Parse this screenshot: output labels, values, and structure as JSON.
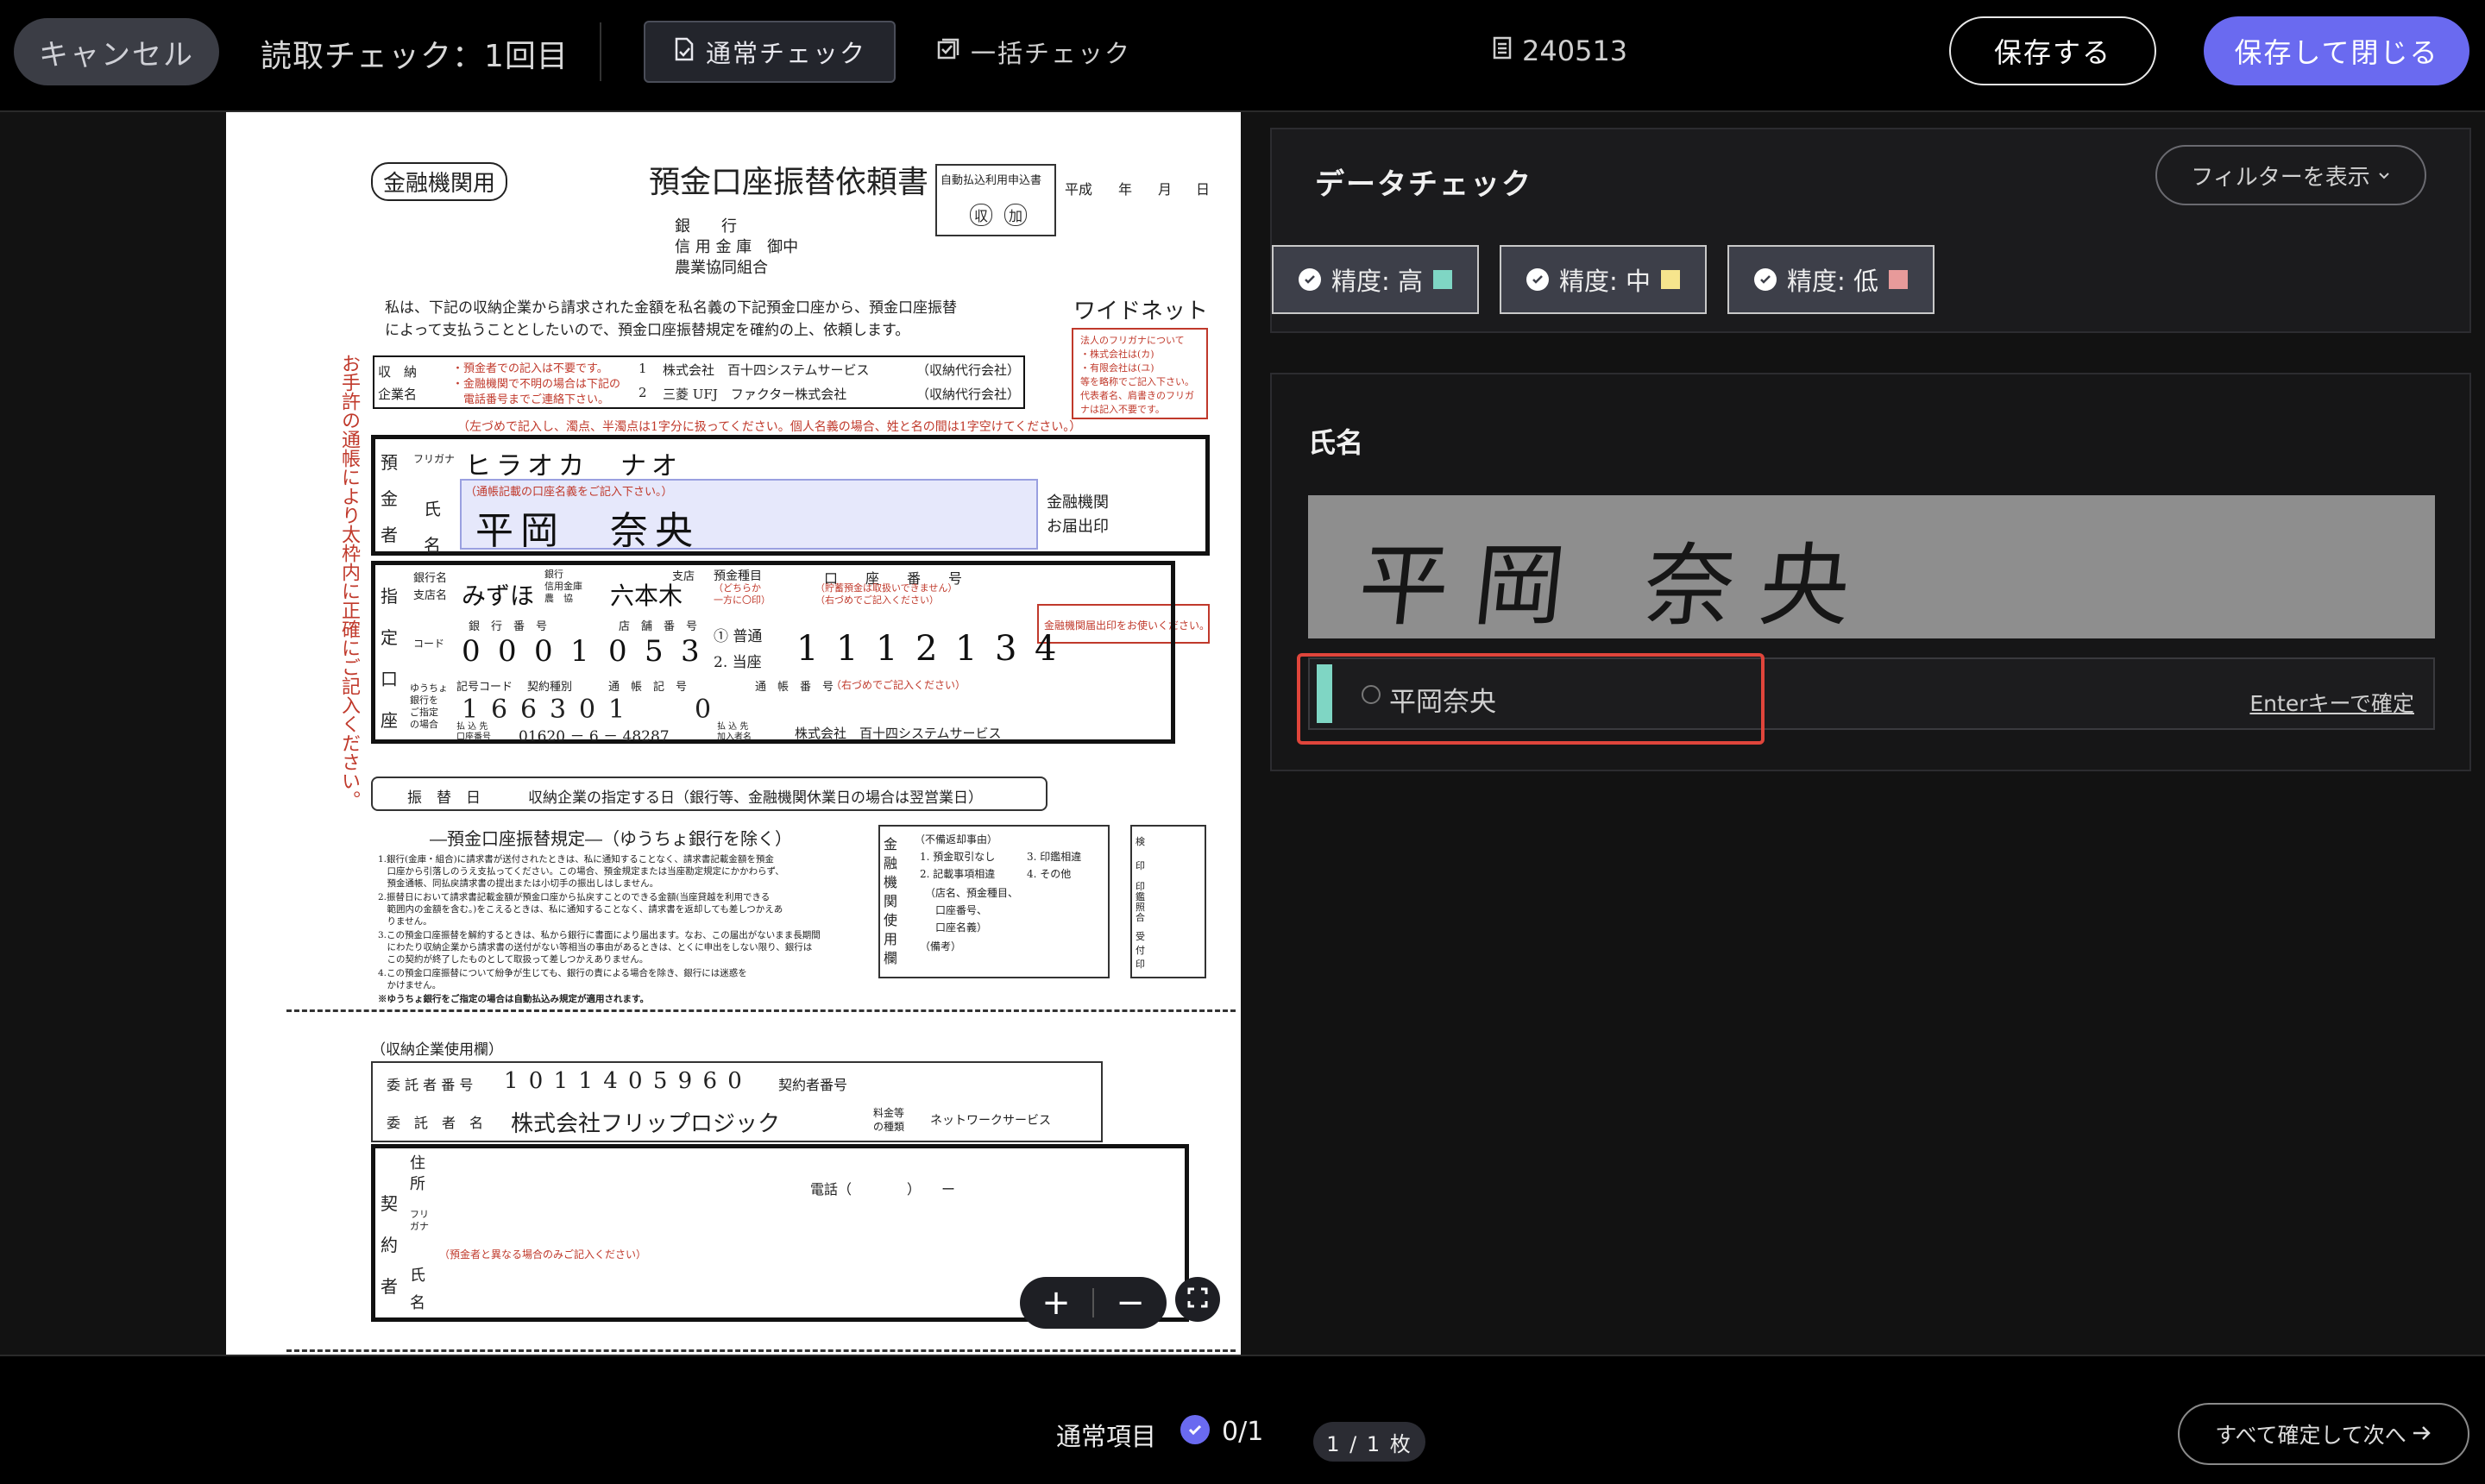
{
  "topbar": {
    "cancel_label": "キャンセル",
    "title": "読取チェック：1回目",
    "tab_normal_label": "通常チェック",
    "tab_bulk_label": "一括チェック",
    "document_id": "240513",
    "save_label": "保存する",
    "save_close_label": "保存して閉じる"
  },
  "document": {
    "badge": "金融機関用",
    "title": "預金口座振替依頼書",
    "autopay_box": "自動払込利用申込書",
    "autopay_marks": [
      "収",
      "加"
    ],
    "date_labels": [
      "平成",
      "年",
      "月",
      "日"
    ],
    "bank_types": [
      "銀　　行",
      "信 用 金 庫　御中",
      "農業協同組合"
    ],
    "intro_line1": "私は、下記の収納企業から請求された金額を私名義の下記預金口座から、預金口座振替",
    "intro_line2": "によって支払うこととしたいので、預金口座振替規定を確約の上、依頼します。",
    "widenet": "ワイドネット",
    "vertical_note": "お手許の通帳により太枠内に正確にご記入ください。",
    "company_header": "収　納\n企業名",
    "company_notes": [
      "・預金者での記入は不要です。",
      "・金融機関で不明の場合は下記の",
      "　電話番号までご連絡下さい。"
    ],
    "companies": [
      {
        "no": "1",
        "name": "株式会社　百十四システムサービス",
        "role": "（収納代行会社）"
      },
      {
        "no": "2",
        "name": "三菱 UFJ　ファクター株式会社",
        "role": "（収納代行会社）"
      }
    ],
    "corp_notes": [
      "法人のフリガナについて",
      "・株式会社は(カ)",
      "・有限会社は(ユ)",
      "等を略称でご記入下さい。",
      "代表者名、肩書きのフリガ",
      "ナは記入不要です。"
    ],
    "kana_instruction": "（左づめで記入し、濁点、半濁点は1字分に扱ってください。個人名義の場合、姓と名の間は1字空けてください。）",
    "depositor_label": "預\n金\n者",
    "furigana_label": "フリガナ",
    "furigana_value": "ヒラオカ　ナオ",
    "name_label": "氏\n名",
    "name_note": "（通帳記載の口座名義をご記入下さい。）",
    "name_value": "平岡　奈央",
    "bank_seal_label": "金融機関\nお届出印",
    "account_label": "指\n定\n口\n座",
    "bank_name_label": "銀行名\n支店名",
    "bank_name_value": "みずほ",
    "branch_value": "六本木",
    "branch_suffix": "支店",
    "bank_kinds": "銀行\n信用金庫\n農　協",
    "deposit_type_label": "預金種目",
    "deposit_type_note": "（どちらか\n一方に〇印）",
    "account_number_label": "口　　座　　番　　号",
    "account_number_note": "（貯蓄預金は取扱いできません）\n（右づめでご記入ください）",
    "code_label": "コード",
    "bank_no_label": "銀　行　番　号",
    "bank_no_digits": [
      "0",
      "0",
      "0",
      "1"
    ],
    "branch_no_label": "店　舗　番　号",
    "branch_no_digits": [
      "0",
      "5",
      "3"
    ],
    "deposit_types": [
      "① 普通",
      "2. 当座"
    ],
    "account_digits": [
      "1",
      "1",
      "1",
      "2",
      "1",
      "3",
      "4"
    ],
    "yucho_label": "ゆうちょ\n銀行を\nご指定\nの場合",
    "symbol_code_label": "記号コード",
    "contract_type_label": "契約種別",
    "passbook_symbol_label": "通　帳　記　号",
    "passbook_number_label": "通　帳　番　号",
    "passbook_number_note": "（右づめでご記入ください）",
    "symbol_digits": [
      "1",
      "6",
      "6",
      "3",
      "0",
      "1",
      "",
      "0"
    ],
    "payee_account_label": "払 込 先\n口座番号",
    "payee_account_value": "01620 － 6 － 48287",
    "payee_member_label": "払 込 先\n加入者名",
    "payee_member_value": "株式会社　百十四システムサービス",
    "transfer_day_label": "振　替　日",
    "transfer_day_value": "収納企業の指定する日（銀行等、金融機関休業日の場合は翌営業日）",
    "rules_title": "―預金口座振替規定―（ゆうちょ銀行を除く）",
    "rules": [
      "1.銀行(金庫・組合)に請求書が送付されたときは、私に通知することなく、請求書記載金額を預金",
      "　口座から引落しのうえ支払ってください。この場合、預金規定または当座勘定規定にかかわらず、",
      "　預金通帳、同払戻請求書の提出または小切手の振出しはしません。",
      "2.振替日において請求書記載金額が預金口座から払戻すことのできる金額(当座貸越を利用できる",
      "　範囲内の金額を含む。)をこえるときは、私に通知することなく、請求書を返却しても差しつかえあ",
      "　りません。",
      "3.この預金口座振替を解約するときは、私から銀行に書面により届出ます。なお、この届出がないまま長期間",
      "　にわたり収納企業から請求書の送付がない等相当の事由があるときは、とくに申出をしない限り、銀行は",
      "　この契約が終了したものとして取扱って差しつかえありません。",
      "4.この預金口座振替について紛争が生じても、銀行の責による場合を除き、銀行には迷惑を",
      "　かけません。",
      "※ゆうちょ銀行をご指定の場合は自動払込み規定が適用されます。"
    ],
    "bank_use_label": "金\n融\n機\n関\n使\n用\n欄",
    "return_reasons_title": "（不備返却事由）",
    "return_reasons": [
      "1. 預金取引なし",
      "3. 印鑑相違",
      "2. 記載事項相違",
      "4. その他",
      "（店名、預金種目、",
      "　口座番号、",
      "　口座名義）",
      "（備考）"
    ],
    "stamp_labels": [
      "検\n印",
      "印\n鑑\n照\n合",
      "受\n付\n印"
    ],
    "to_stamp_note": "金融機関届出印をお使いください。",
    "company_use_label": "（収納企業使用欄）",
    "consignor_no_label": "委 託 者 番 号",
    "consignor_no_value": "1 0 1 1 4 0 5 9 6 0",
    "contractor_no_label": "契約者番号",
    "consignor_name_label": "委　託　者　名",
    "consignor_name_value": "株式会社フリップロジック",
    "fee_type_label": "料金等\nの種類",
    "fee_type_value": "ネットワークサービス",
    "contractor_label": "契\n約\n者",
    "address_label": "住\n所",
    "phone_label": "電話（　　　　）　　ー",
    "contractor_furigana_label": "フリ\nガナ",
    "contractor_name_label": "氏\n名",
    "contractor_name_note": "（預金者と異なる場合のみご記入ください）"
  },
  "viewer": {
    "zoom_in": "+",
    "zoom_out": "−"
  },
  "panel": {
    "title": "データチェック",
    "filter_label": "フィルターを表示",
    "chips": [
      {
        "label": "精度: 高",
        "color": "#7fd6c4"
      },
      {
        "label": "精度: 中",
        "color": "#f6e58d"
      },
      {
        "label": "精度: 低",
        "color": "#e79a9a"
      }
    ],
    "field": {
      "label": "氏名",
      "crop_text": "平岡 奈央",
      "value": "平岡奈央",
      "hint": "Enterキーで確定"
    }
  },
  "bottombar": {
    "item_label": "通常項目",
    "count": "0/1",
    "page": "1 / 1 枚",
    "next_label": "すべて確定して次へ"
  },
  "colors": {
    "accent": "#6a6af0",
    "high": "#7fd6c4",
    "highlight_frame": "#e0453b"
  }
}
